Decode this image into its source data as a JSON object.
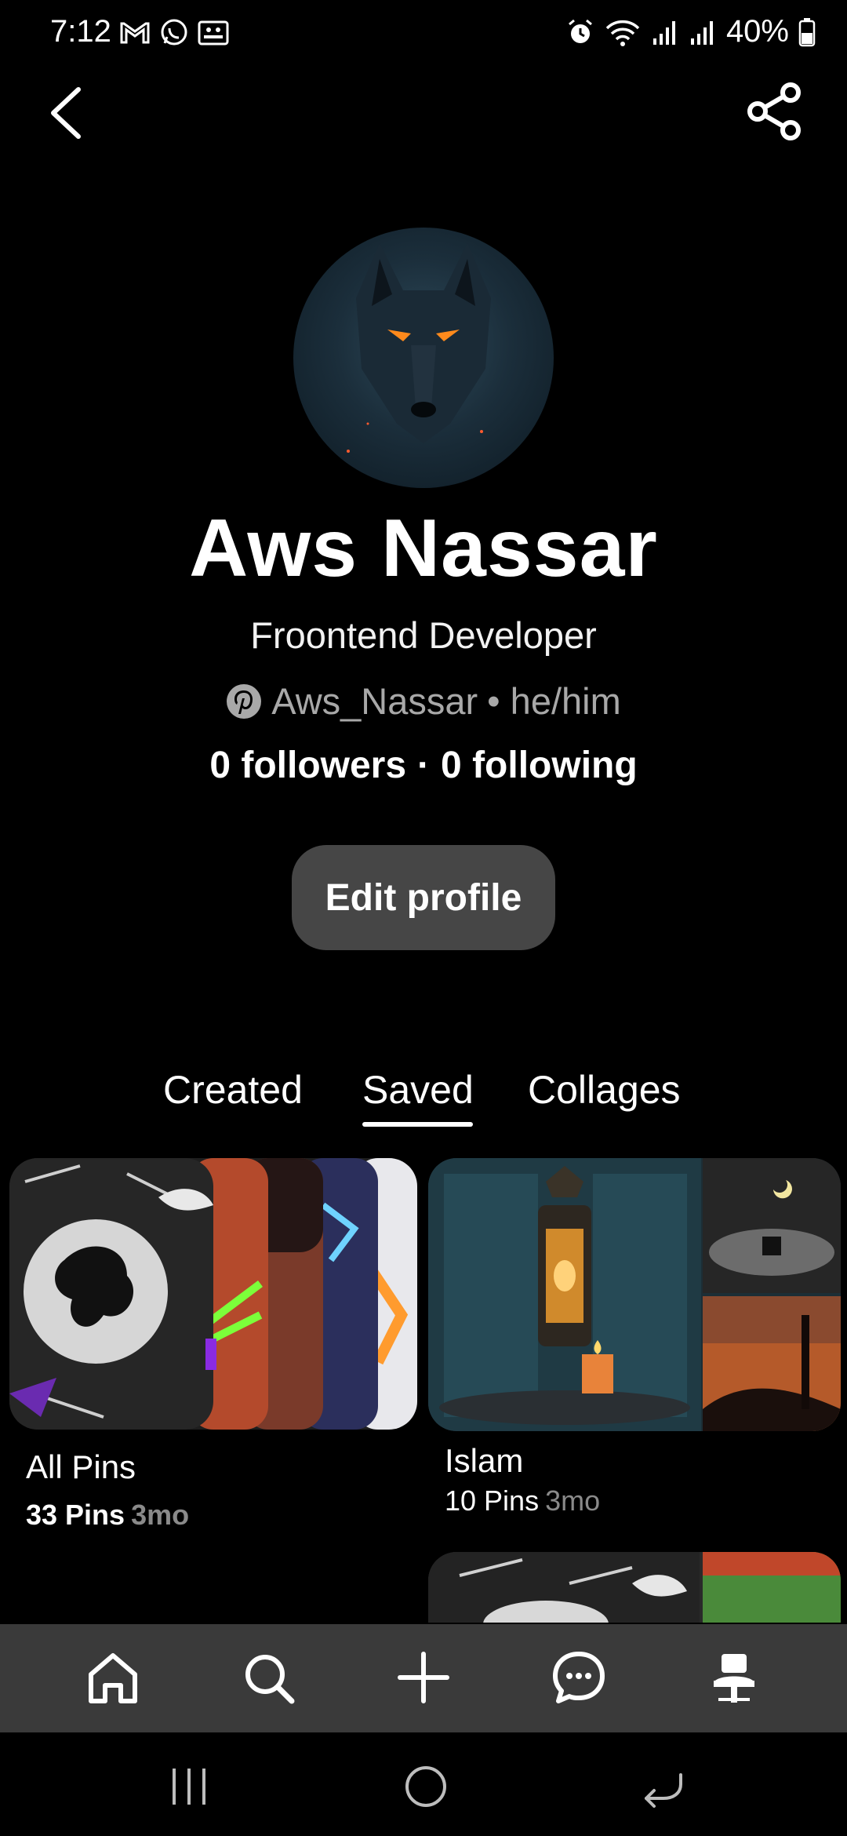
{
  "status_bar": {
    "time": "7:12",
    "battery": "40%",
    "icons": [
      "gmail-icon",
      "whatsapp-icon",
      "gallery-icon",
      "alarm-icon",
      "wifi-icon",
      "signal-icon",
      "signal-icon",
      "battery-icon"
    ]
  },
  "header": {
    "back_icon": "chevron-left-icon",
    "share_icon": "share-icon"
  },
  "profile": {
    "name": "Aws Nassar",
    "bio": "Froontend Developer",
    "handle": "Aws_Nassar",
    "pronouns": "• he/him",
    "followers": "0 followers",
    "separator": "·",
    "following": "0 following",
    "edit_label": "Edit profile"
  },
  "tabs": [
    {
      "label": "Created",
      "active": false
    },
    {
      "label": "Saved",
      "active": true
    },
    {
      "label": "Collages",
      "active": false
    }
  ],
  "boards": [
    {
      "title": "All Pins",
      "count": "33 Pins",
      "age": "3mo"
    },
    {
      "title": "Islam",
      "count": "10 Pins",
      "age": "3mo"
    }
  ],
  "bottom_nav": [
    "home-icon",
    "search-icon",
    "plus-icon",
    "messages-icon",
    "saved-pin-icon"
  ],
  "system_nav": [
    "recents-icon",
    "home-circle-icon",
    "back-icon"
  ],
  "colors": {
    "background": "#000000",
    "button": "#464646",
    "nav_bar": "#3a3a3a",
    "muted_text": "#a8a8a8"
  }
}
